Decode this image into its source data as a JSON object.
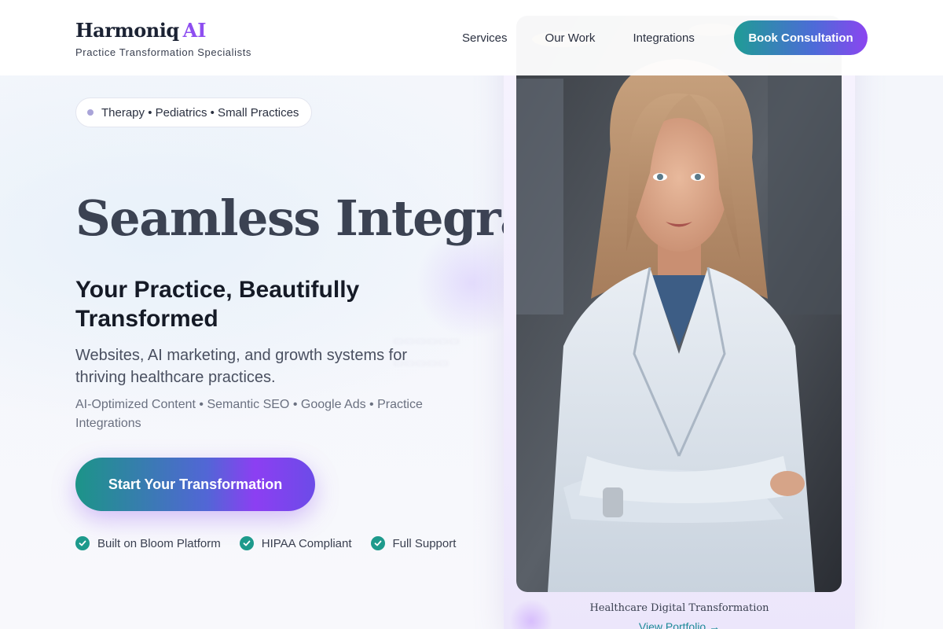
{
  "brand": {
    "name": "Harmoniq",
    "ai": "AI",
    "tagline": "Practice Transformation Specialists"
  },
  "nav": {
    "items": [
      "Services",
      "Our Work",
      "Integrations"
    ],
    "cta": "Book Consultation"
  },
  "hero": {
    "pill": "Therapy • Pediatrics • Small Practices",
    "headline": "Seamless Integrations",
    "subhead": "Your Practice, Beautifully Transformed",
    "description": "Websites, AI marketing, and growth systems for thriving healthcare practices.",
    "features": "AI-Optimized Content • Semantic SEO • Google Ads • Practice Integrations",
    "cta": "Start Your Transformation",
    "badges": [
      "Built on Bloom Platform",
      "HIPAA Compliant",
      "Full Support"
    ]
  },
  "card": {
    "caption": "Healthcare Digital Transformation",
    "link": "View Portfolio →"
  },
  "colors": {
    "accent_teal": "#1d9a8c",
    "accent_purple": "#8b45f0",
    "heading": "#151a26"
  }
}
